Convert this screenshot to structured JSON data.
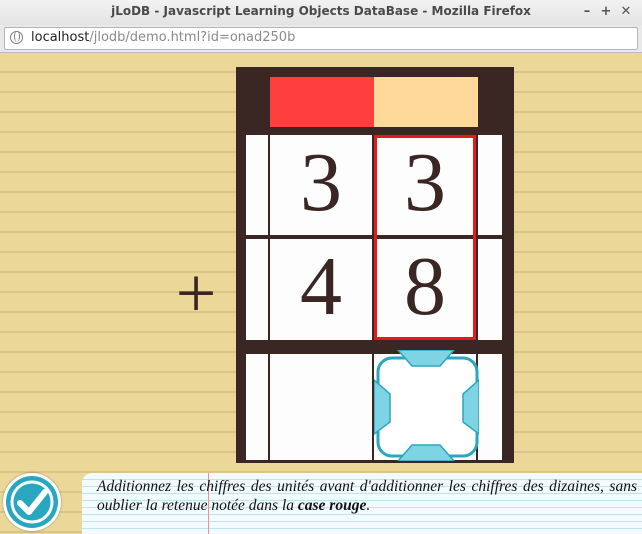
{
  "window": {
    "title": "jLoDB - Javascript Learning Objects DataBase - Mozilla Firefox",
    "controls": {
      "minimize": "–",
      "maximize": "+",
      "close": "✕"
    }
  },
  "address_bar": {
    "host": "localhost",
    "path": "/jlodb/demo.html?id=onad250b",
    "icon": "globe-icon"
  },
  "exercise": {
    "operator": "+",
    "header_colors": {
      "tens": "#ff3e3e",
      "units": "#ffd999"
    },
    "rows": [
      {
        "tens": "3",
        "units": "3"
      },
      {
        "tens": "4",
        "units": "8"
      }
    ],
    "result": {
      "tens": "",
      "units": ""
    },
    "highlight_color": "#e51a1a",
    "selector_color": "#2aa7c0"
  },
  "instruction": {
    "text_before": "Additionnez les chiffres des unités avant d'additionner les chiffres des dizaines, sans oublier la retenue notée dans la ",
    "emphasis": "case rouge",
    "text_after": "."
  },
  "validate_button": {
    "icon": "checkmark-icon",
    "color": "#2aa7c0"
  }
}
